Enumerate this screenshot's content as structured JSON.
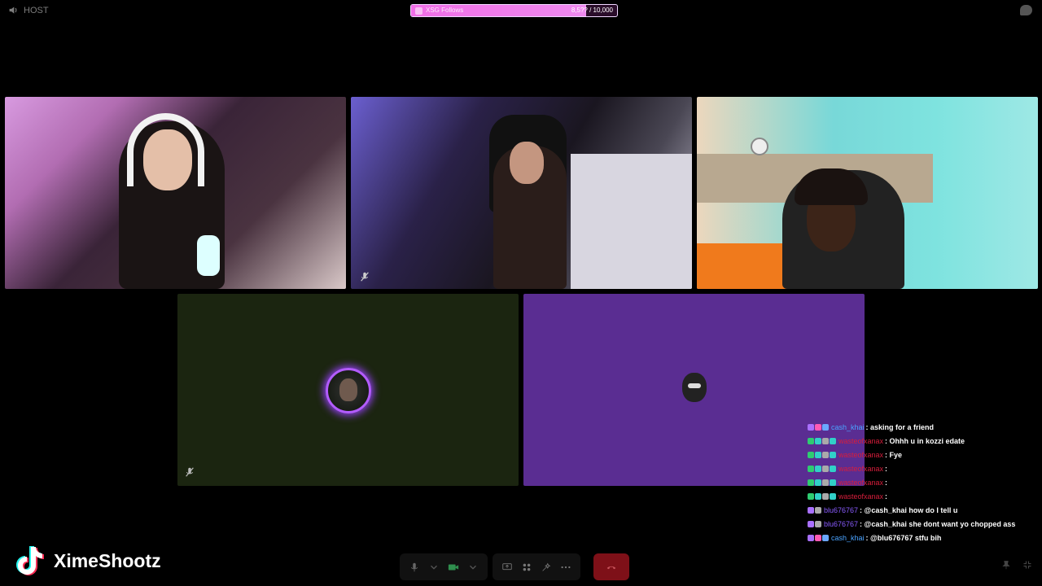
{
  "host": {
    "label": "HOST"
  },
  "goal": {
    "title": "XSG Follows",
    "count_text": "8,5?? / 10,000",
    "progress": 0.85,
    "fill_color": "#f06ee6"
  },
  "participants": [
    {
      "id": "cam1",
      "type": "video",
      "scene": "girl with white headset"
    },
    {
      "id": "cam2",
      "type": "video",
      "scene": "girl at desk"
    },
    {
      "id": "cam3",
      "type": "video",
      "scene": "boy with headset"
    },
    {
      "id": "audio1",
      "type": "audio",
      "bg_color": "#1b2510",
      "ring_color": "#b35cff"
    },
    {
      "id": "audio2",
      "type": "audio",
      "bg_color": "#5a2d92"
    }
  ],
  "chat": [
    {
      "user": "cash_khai",
      "user_color": "#4aa3ff",
      "message": ": asking for a friend",
      "badges": [
        "b-purple",
        "b-pink",
        "b-blue"
      ]
    },
    {
      "user": "wasteofxanax",
      "user_color": "#d81e3c",
      "message": ": Ohhh u in kozzi edate",
      "badges": [
        "b-green",
        "b-teal",
        "b-grey",
        "b-teal"
      ]
    },
    {
      "user": "wasteofxanax",
      "user_color": "#d81e3c",
      "message": ": Fye",
      "badges": [
        "b-green",
        "b-teal",
        "b-grey",
        "b-teal"
      ]
    },
    {
      "user": "wasteofxanax",
      "user_color": "#d81e3c",
      "message": ":",
      "badges": [
        "b-green",
        "b-teal",
        "b-grey",
        "b-teal"
      ]
    },
    {
      "user": "wasteofxanax",
      "user_color": "#d81e3c",
      "message": ":",
      "badges": [
        "b-green",
        "b-teal",
        "b-grey",
        "b-teal"
      ]
    },
    {
      "user": "wasteofxanax",
      "user_color": "#d81e3c",
      "message": ":",
      "badges": [
        "b-green",
        "b-teal",
        "b-grey",
        "b-teal"
      ]
    },
    {
      "user": "blu676767",
      "user_color": "#8a5cff",
      "message": ": @cash_khai how do I tell u",
      "badges": [
        "b-purple",
        "b-grey"
      ]
    },
    {
      "user": "blu676767",
      "user_color": "#8a5cff",
      "message": ": @cash_khai she dont want yo chopped ass",
      "badges": [
        "b-purple",
        "b-grey"
      ]
    },
    {
      "user": "cash_khai",
      "user_color": "#4aa3ff",
      "message": ": @blu676767 stfu bih",
      "badges": [
        "b-purple",
        "b-pink",
        "b-blue"
      ]
    }
  ],
  "brand": {
    "name": "XimeShootz",
    "icon": "tiktok-icon"
  },
  "controls": {
    "icons": [
      "microphone-icon",
      "chevron-down-icon",
      "camera-icon",
      "chevron-down-icon",
      "screen-share-icon",
      "apps-icon",
      "effects-icon",
      "more-icon",
      "end-call-icon"
    ],
    "end_color": "#7e1018"
  }
}
